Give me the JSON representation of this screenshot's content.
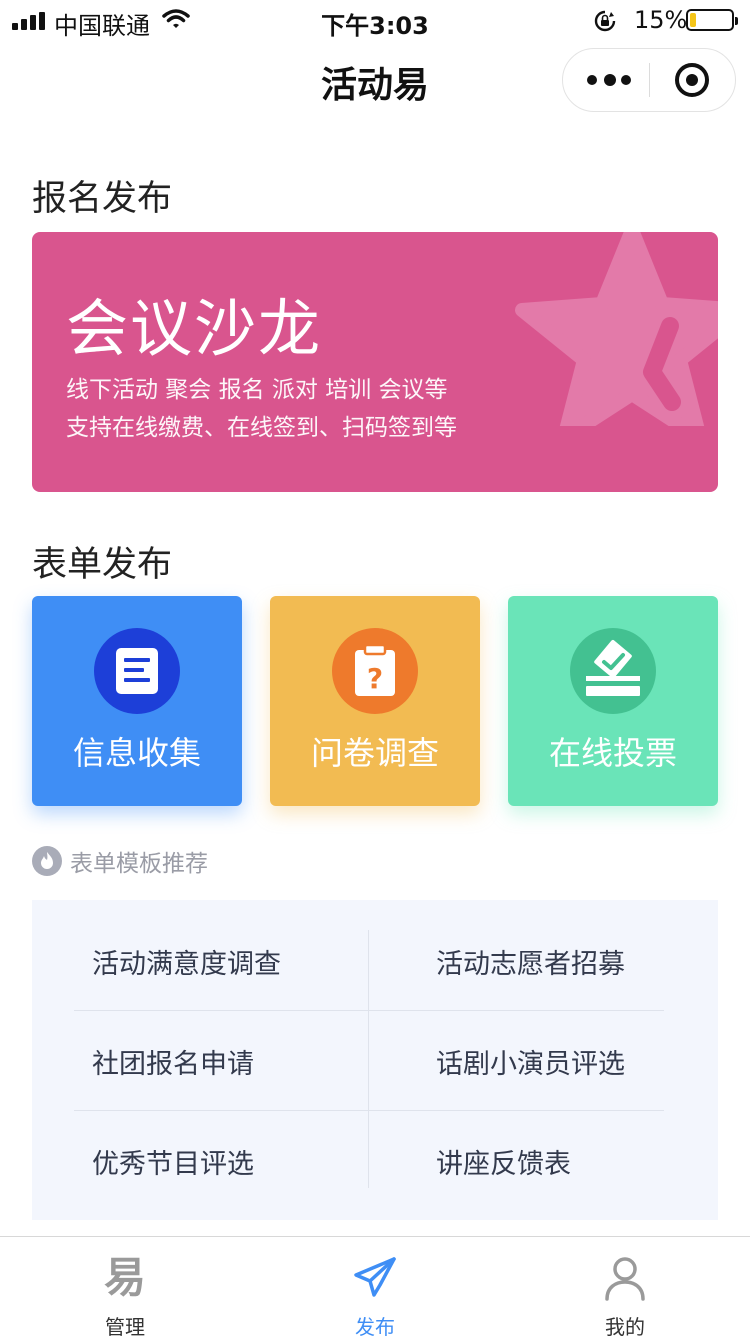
{
  "status_bar": {
    "carrier": "中国联通",
    "time": "下午3:03",
    "battery_percent": "15%",
    "battery_level": 0.15,
    "icons": [
      "signal-icon",
      "wifi-icon",
      "rotation-lock-icon",
      "battery-icon"
    ]
  },
  "nav": {
    "title": "活动易",
    "icons": [
      "more-icon",
      "target-icon"
    ]
  },
  "section_signup": {
    "title": "报名发布",
    "banner": {
      "title": "会议沙龙",
      "line1": "线下活动 聚会 报名 派对 培训 会议等",
      "line2": "支持在线缴费、在线签到、扫码签到等",
      "color": "#d9558e",
      "icon": "star-icon"
    }
  },
  "section_form": {
    "title": "表单发布",
    "cards": [
      {
        "label": "信息收集",
        "icon": "document-icon",
        "color": "#3f8ef5"
      },
      {
        "label": "问卷调查",
        "icon": "clipboard-question-icon",
        "color": "#f2bb52"
      },
      {
        "label": "在线投票",
        "icon": "ballot-box-icon",
        "color": "#6ae4b8"
      }
    ]
  },
  "templates": {
    "header": "表单模板推荐",
    "icon": "fire-icon",
    "items": [
      "活动满意度调查",
      "活动志愿者招募",
      "社团报名申请",
      "话剧小演员评选",
      "优秀节目评选",
      "讲座反馈表"
    ]
  },
  "tabbar": {
    "active_color": "#3f8ef5",
    "tabs": [
      {
        "label": "管理",
        "glyph": "易",
        "icon": "manage-icon"
      },
      {
        "label": "发布",
        "icon": "paper-plane-icon",
        "active": true
      },
      {
        "label": "我的",
        "icon": "person-icon"
      }
    ]
  }
}
